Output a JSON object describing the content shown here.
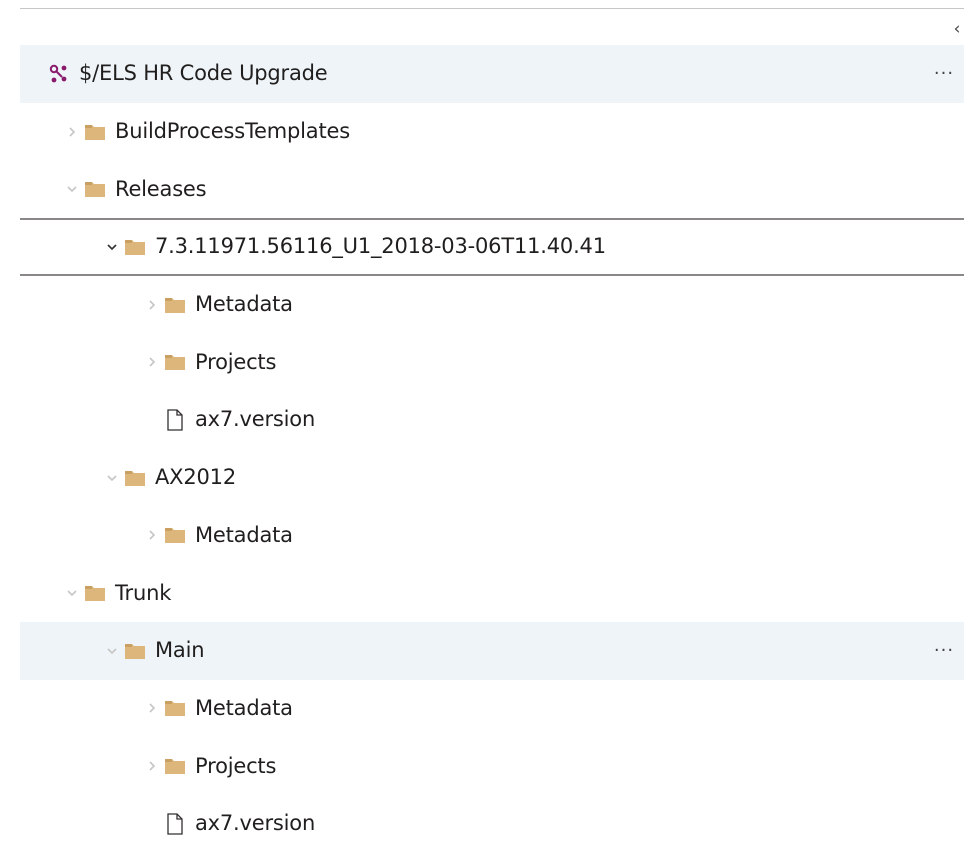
{
  "panel": {
    "collapse_glyph": "‹",
    "more_glyph": "···"
  },
  "tree": {
    "rows": [
      {
        "label": "$/ELS HR Code Upgrade",
        "kind": "repo",
        "depth": 0
      },
      {
        "label": "BuildProcessTemplates",
        "kind": "folder",
        "depth": 1,
        "expanded": false
      },
      {
        "label": "Releases",
        "kind": "folder",
        "depth": 1,
        "expanded": true
      },
      {
        "label": "7.3.11971.56116_U1_2018-03-06T11.40.41",
        "kind": "folder",
        "depth": 2,
        "expanded": true,
        "focused": true
      },
      {
        "label": "Metadata",
        "kind": "folder",
        "depth": 3,
        "expanded": false
      },
      {
        "label": "Projects",
        "kind": "folder",
        "depth": 3,
        "expanded": false
      },
      {
        "label": "ax7.version",
        "kind": "file",
        "depth": 3
      },
      {
        "label": "AX2012",
        "kind": "folder",
        "depth": 2,
        "expanded": true
      },
      {
        "label": "Metadata",
        "kind": "folder",
        "depth": 3,
        "expanded": false
      },
      {
        "label": "Trunk",
        "kind": "folder",
        "depth": 1,
        "expanded": true
      },
      {
        "label": "Main",
        "kind": "folder",
        "depth": 2,
        "expanded": true,
        "selected": true
      },
      {
        "label": "Metadata",
        "kind": "folder",
        "depth": 3,
        "expanded": false
      },
      {
        "label": "Projects",
        "kind": "folder",
        "depth": 3,
        "expanded": false
      },
      {
        "label": "ax7.version",
        "kind": "file",
        "depth": 3
      }
    ]
  },
  "colors": {
    "folder": "#dcb67a",
    "repo_icon": "#8a1a6c",
    "selected_row": "#eff4f9",
    "chevron_faint": "#c8c6c4",
    "chevron_strong": "#323130"
  },
  "icons": {
    "repo": "repository-icon",
    "folder": "folder-icon",
    "file": "file-icon",
    "expanded": "chevron-down-icon",
    "collapsed": "chevron-right-icon"
  }
}
